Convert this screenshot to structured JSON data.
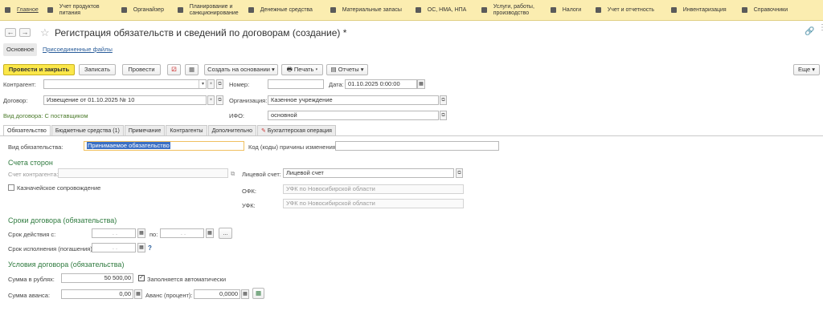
{
  "menu": [
    {
      "label": "Главное",
      "icon": "grid-icon"
    },
    {
      "label": "Учет продуктов питания",
      "icon": "food-icon"
    },
    {
      "label": "Органайзер",
      "icon": "organizer-icon"
    },
    {
      "label": "Планирование и санкционирование",
      "icon": "plan-icon"
    },
    {
      "label": "Денежные средства",
      "icon": "money-icon"
    },
    {
      "label": "Материальные запасы",
      "icon": "inventory-icon"
    },
    {
      "label": "ОС, НМА, НПА",
      "icon": "truck-icon"
    },
    {
      "label": "Услуги, работы, производство",
      "icon": "services-icon"
    },
    {
      "label": "Налоги",
      "icon": "taxes-icon"
    },
    {
      "label": "Учет и отчетность",
      "icon": "reports-icon"
    },
    {
      "label": "Инвентаризация",
      "icon": "inventory-check-icon"
    },
    {
      "label": "Справочники",
      "icon": "book-icon"
    }
  ],
  "title": "Регистрация обязательств и сведений по договорам (создание) *",
  "subtabs": {
    "main": "Основное",
    "files": "Присоединенные файлы"
  },
  "toolbar": {
    "post_close": "Провести и закрыть",
    "save": "Записать",
    "post": "Провести",
    "create_based": "Создать на основании",
    "print": "Печать",
    "reports": "Отчеты",
    "more": "Еще"
  },
  "header": {
    "contractor_label": "Контрагент:",
    "contractor_value": "",
    "number_label": "Номер:",
    "number_value": "",
    "date_label": "Дата:",
    "date_value": "01.10.2025  0:00:00",
    "contract_label": "Договор:",
    "contract_value": "Извещение от 01.10.2025 № 10",
    "org_label": "Организация:",
    "org_value": "Казенное учреждение",
    "contract_type": "Вид договора: С поставщиком",
    "ifo_label": "ИФО:",
    "ifo_value": "основной"
  },
  "tabs": [
    "Обязательство",
    "Бюджетные средства (1)",
    "Примечание",
    "Контрагенты",
    "Дополнительно",
    "Бухгалтерская операция"
  ],
  "obligation": {
    "kind_label": "Вид обязательства:",
    "kind_value": "Принимаемое обязательство",
    "reason_label": "Код (коды) причины изменения:",
    "reason_value": ""
  },
  "accounts": {
    "title": "Счета сторон",
    "contractor_account_label": "Счет контрагента:",
    "contractor_account_value": "",
    "personal_account_label": "Лицевой счет:",
    "personal_account_value": "Лицевой счет",
    "treasury_label": "Казначейское сопровождение",
    "ofk_label": "ОФК:",
    "ofk_value": "УФК по Новосибирской области",
    "ufk_label": "УФК:",
    "ufk_value": "УФК по Новосибирской области"
  },
  "terms": {
    "title": "Сроки договора (обязательства)",
    "from_label": "Срок действия с:",
    "from_value": ".  .",
    "to_label": "по:",
    "to_value": ".  .",
    "exec_label": "Срок исполнения (погашения):",
    "exec_value": ".  .",
    "more": "...",
    "help": "?"
  },
  "conditions": {
    "title": "Условия договора (обязательства)",
    "sum_label": "Сумма в рублях:",
    "sum_value": "50 500,00",
    "auto_label": "Заполняется автоматически",
    "advance_label": "Сумма аванса:",
    "advance_value": "0,00",
    "advance_pct_label": "Аванс (процент):",
    "advance_pct_value": "0,0000"
  },
  "colors": {
    "menubar": "#fbedb0",
    "primary_button": "#fbe74a",
    "section": "#2e7a3e",
    "link": "#2a5d9a",
    "selection": "#3a6fc4"
  }
}
